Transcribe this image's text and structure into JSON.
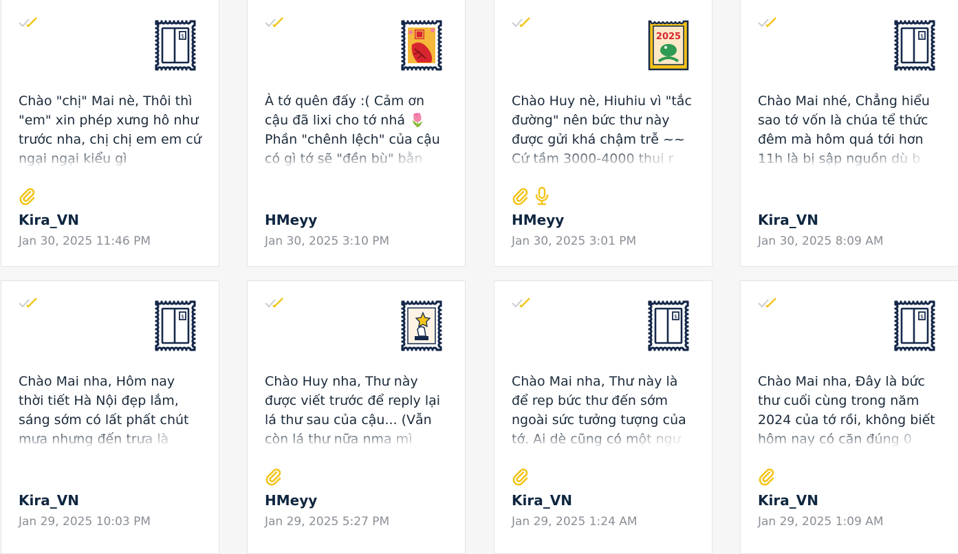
{
  "colors": {
    "accent": "#f3c318",
    "navy": "#15284a",
    "muted": "#8a8f96"
  },
  "cards": [
    {
      "stamp": "plain-stamp-icon",
      "preview": "Chào \"chị\" Mai nè, Thôi thì \"em\" xin phép xưng hô như trước nha, chị chị em em cứ ngại ngại kiểu gì",
      "author": "Kira_VN",
      "date": "Jan 30, 2025 11:46 PM",
      "attachment": true,
      "voice": false
    },
    {
      "stamp": "red-envelope-stamp-icon",
      "preview": "À tớ quên đấy :( Cảm ơn cậu đã lixi cho tớ nhá 🌷 Phần \"chênh lệch\" của cậu có gì tớ sẽ \"đền bù\" bằn",
      "author": "HMeyy",
      "date": "Jan 30, 2025 3:10 PM",
      "attachment": false,
      "voice": false
    },
    {
      "stamp": "dragon-2025-stamp-icon",
      "preview": "Chào Huy nè, Hiuhiu vì \"tắc đường\" nên bức thư này được gửi khá chậm trễ ~~ Cứ tầm 3000-4000 thui r",
      "author": "HMeyy",
      "date": "Jan 30, 2025 3:01 PM",
      "attachment": true,
      "voice": true
    },
    {
      "stamp": "plain-stamp-icon",
      "preview": "Chào Mai nhé, Chẳng hiểu sao tớ vốn là chúa tể thức đêm mà hôm quá tới hơn 11h là bị sập nguồn dù b",
      "author": "Kira_VN",
      "date": "Jan 30, 2025 8:09 AM",
      "attachment": false,
      "voice": false
    },
    {
      "stamp": "plain-stamp-icon",
      "preview": "Chào Mai nha, Hôm nay thời tiết Hà Nội đẹp lắm, sáng sớm có lất phất chút mưa nhưng đến trưa là",
      "author": "Kira_VN",
      "date": "Jan 29, 2025 10:03 PM",
      "attachment": false,
      "voice": false
    },
    {
      "stamp": "star-hand-stamp-icon",
      "preview": "Chào Huy nha, Thư này được viết trước để reply lại lá thư sau của cậu... (Vẫn còn lá thư nữa nma mì",
      "author": "HMeyy",
      "date": "Jan 29, 2025 5:27 PM",
      "attachment": true,
      "voice": false
    },
    {
      "stamp": "plain-stamp-icon",
      "preview": "Chào Mai nha, Thư này là để rep bức thư đến sớm ngoài sức tưởng tượng của tớ. Ai dè cũng có một ngư",
      "author": "Kira_VN",
      "date": "Jan 29, 2025 1:24 AM",
      "attachment": true,
      "voice": false
    },
    {
      "stamp": "plain-stamp-icon",
      "preview": "Chào Mai nha, Đây là bức thư cuối cùng trong năm 2024 của tớ rồi, không biết hôm nay có căn đúng 0",
      "author": "Kira_VN",
      "date": "Jan 29, 2025 1:09 AM",
      "attachment": true,
      "voice": false
    }
  ]
}
